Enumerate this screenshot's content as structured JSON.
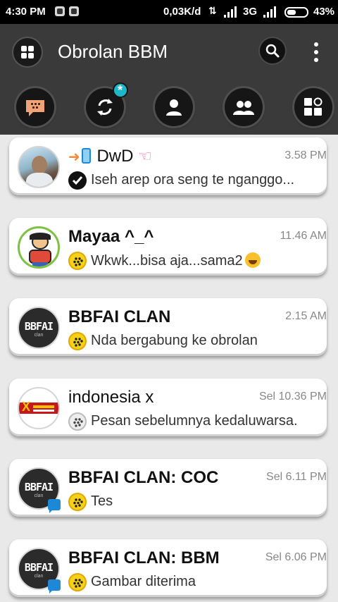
{
  "status_bar": {
    "time": "4:30 PM",
    "speed": "0,03K/d",
    "network": "3G",
    "battery": "43%"
  },
  "app_bar": {
    "title": "Obrolan BBM",
    "icons": [
      "blackberry-logo-icon",
      "search-icon",
      "more-vert-icon"
    ],
    "tabs": [
      "chats-tab-icon",
      "updates-tab-icon",
      "contacts-tab-icon",
      "groups-tab-icon",
      "channels-tab-icon"
    ]
  },
  "chats": [
    {
      "name_prefix": "→📱",
      "name": "DwD",
      "name_suffix": "👈",
      "bold": false,
      "time": "3.58 PM",
      "message": "Iseh arep ora seng te nganggo...",
      "status": "check"
    },
    {
      "name_prefix": "",
      "name": "Mayaa ^_^",
      "name_suffix": "",
      "bold": true,
      "time": "11.46 AM",
      "message": "Wkwk...bisa aja...sama2",
      "status": "bbm-yellow",
      "emoji": true
    },
    {
      "name_prefix": "",
      "name": "BBFAI CLAN",
      "name_suffix": "",
      "bold": true,
      "time": "2.15 AM",
      "message": "Nda bergabung ke obrolan",
      "status": "bbm-yellow"
    },
    {
      "name_prefix": "",
      "name": "indonesia x",
      "name_suffix": "",
      "bold": false,
      "time": "Sel 10.36 PM",
      "message": "Pesan sebelumnya kedaluwarsa.",
      "status": "bbm-grey"
    },
    {
      "name_prefix": "",
      "name": "BBFAI CLAN: COC",
      "name_suffix": "",
      "bold": true,
      "time": "Sel 6.11 PM",
      "message": "Tes",
      "status": "bbm-yellow"
    },
    {
      "name_prefix": "",
      "name": "BBFAI CLAN: BBM",
      "name_suffix": "",
      "bold": true,
      "time": "Sel 6.06 PM",
      "message": "Gambar diterima",
      "status": "bbm-yellow"
    }
  ],
  "avatar_text": {
    "bbfai": "BBFAI",
    "bbfai_sub": "clan",
    "indonesia": "X"
  }
}
